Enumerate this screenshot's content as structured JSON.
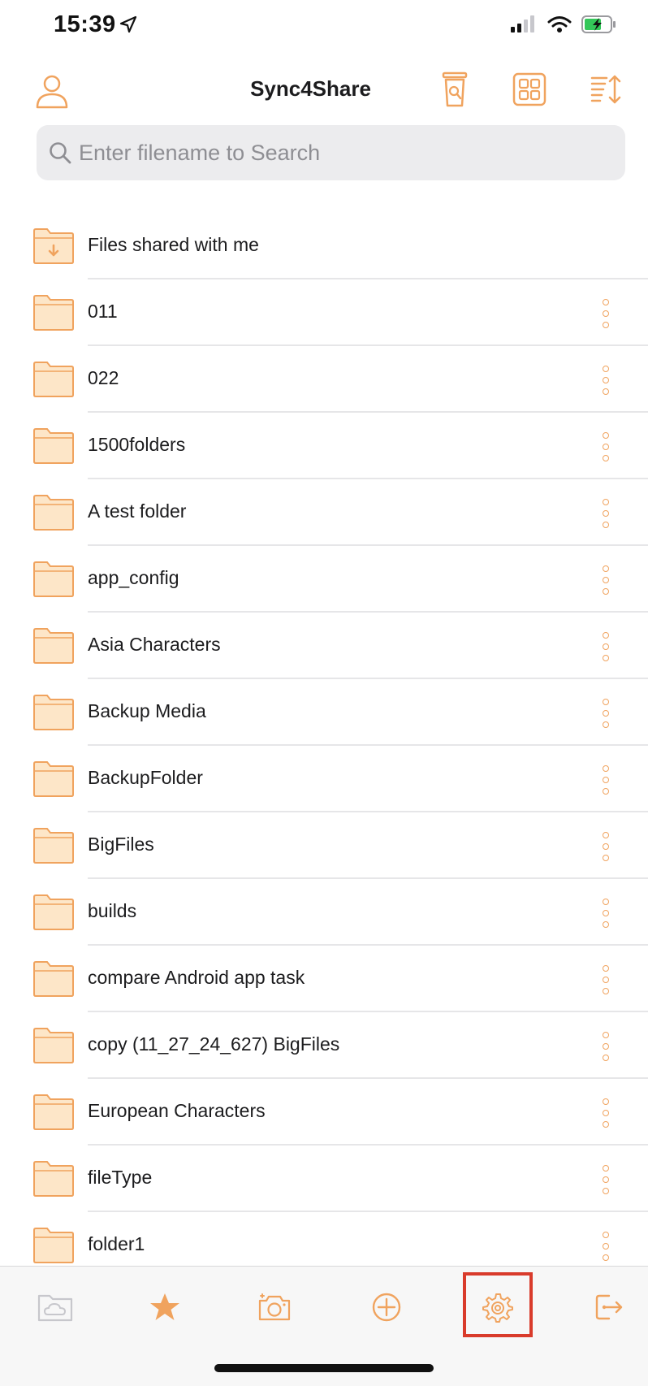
{
  "status_bar": {
    "time": "15:39"
  },
  "header": {
    "title": "Sync4Share"
  },
  "search": {
    "placeholder": "Enter filename to Search",
    "value": ""
  },
  "folders": [
    {
      "name": "Files shared with me",
      "shared": true
    },
    {
      "name": "011"
    },
    {
      "name": "022"
    },
    {
      "name": "1500folders"
    },
    {
      "name": "A test folder"
    },
    {
      "name": "app_config"
    },
    {
      "name": "Asia Characters"
    },
    {
      "name": "Backup Media"
    },
    {
      "name": "BackupFolder"
    },
    {
      "name": "BigFiles"
    },
    {
      "name": "builds"
    },
    {
      "name": "compare Android app task"
    },
    {
      "name": "copy (11_27_24_627) BigFiles"
    },
    {
      "name": "European Characters"
    },
    {
      "name": "fileType"
    },
    {
      "name": "folder1"
    }
  ],
  "tab_bar": {
    "tabs": [
      "cloud-icon",
      "star-icon",
      "camera-icon",
      "plus-circle-icon",
      "gear-icon",
      "logout-icon"
    ],
    "highlighted": "gear-icon"
  },
  "colors": {
    "accent": "#f0a35e",
    "folder_fill": "#fde6c8",
    "highlight": "#d93b2b"
  }
}
